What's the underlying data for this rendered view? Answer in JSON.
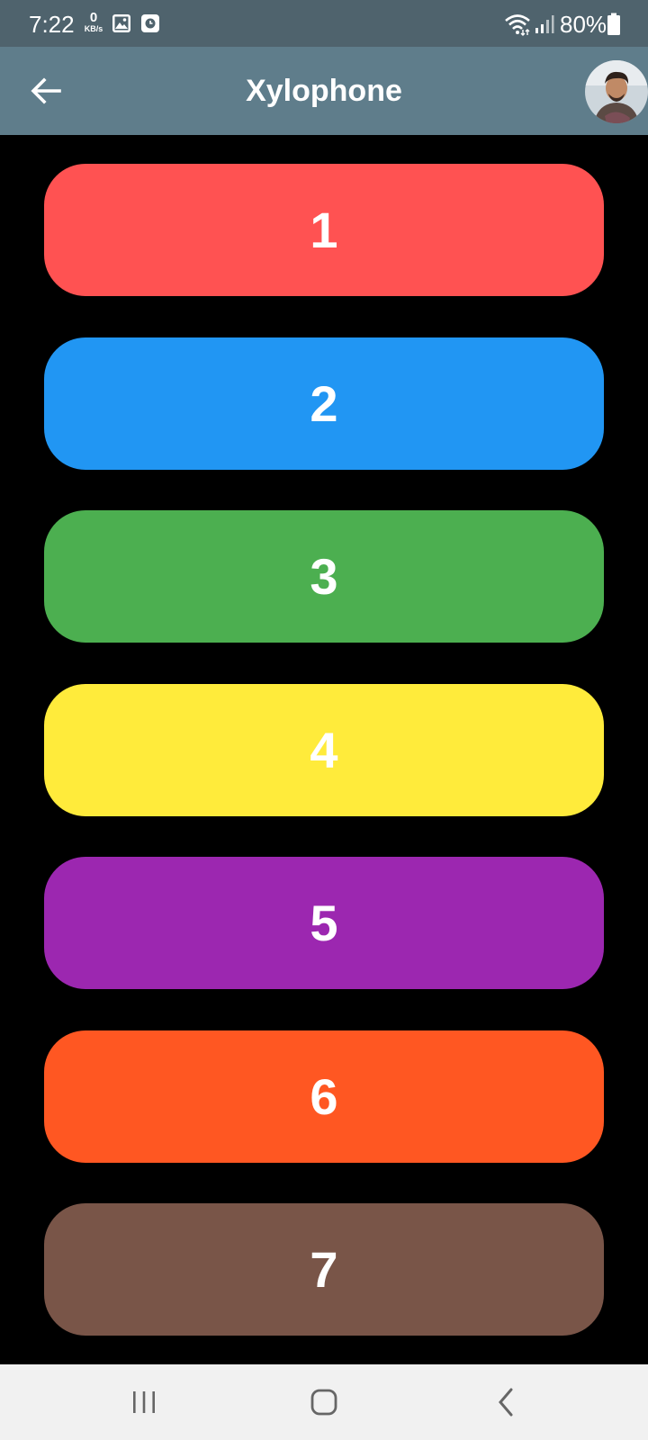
{
  "status_bar": {
    "time": "7:22",
    "net_speed_value": "0",
    "net_speed_unit": "KB/s",
    "battery_percent": "80%",
    "icons": [
      "gallery-icon",
      "clock-app-icon",
      "wifi-icon",
      "signal-icon",
      "battery-icon"
    ]
  },
  "app_bar": {
    "title": "Xylophone",
    "back_icon": "arrow-left-icon",
    "avatar": "profile-photo"
  },
  "keys": [
    {
      "label": "1",
      "color": "#ff5252"
    },
    {
      "label": "2",
      "color": "#2196f3"
    },
    {
      "label": "3",
      "color": "#4caf50"
    },
    {
      "label": "4",
      "color": "#ffeb3b"
    },
    {
      "label": "5",
      "color": "#9c27b0"
    },
    {
      "label": "6",
      "color": "#ff5722"
    },
    {
      "label": "7",
      "color": "#795548"
    }
  ],
  "nav_bar": {
    "icons": [
      "recent-apps-icon",
      "home-icon",
      "back-nav-icon"
    ]
  },
  "colors": {
    "status_bar": "#4f636d",
    "app_bar": "#5f7d8b",
    "background": "#000000",
    "nav_bar": "#f1f1f1"
  }
}
